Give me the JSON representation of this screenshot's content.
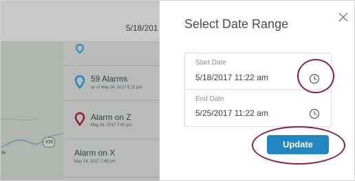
{
  "background": {
    "header_date": "5/18/201",
    "list": [
      {
        "title": "59 Alarms",
        "subtitle": "as of May 24, 2017 8:23 pm",
        "pin_color": "#1f86c3"
      },
      {
        "title": "Alarm on Z",
        "subtitle": "May 24, 2017 7:50 pm",
        "pin_color": "#8f1b3a"
      },
      {
        "title": "Alarm on X",
        "subtitle": "May 24, 2017 7:49 pm"
      }
    ],
    "road_badge": "108",
    "map_label": "le"
  },
  "dialog": {
    "title": "Select Date Range",
    "start_label": "Start Date",
    "start_value": "5/18/2017 11:22 am",
    "end_label": "End Date",
    "end_value": "5/25/2017 11:22 am",
    "update_label": "Update"
  },
  "colors": {
    "accent": "#1f86c3",
    "annotation": "#8f1b3a",
    "overlay": "#b7bab8"
  },
  "icons": {
    "close": "close-icon",
    "start_clock": "clock-icon",
    "end_clock": "clock-icon",
    "pin": "map-pin-icon"
  }
}
